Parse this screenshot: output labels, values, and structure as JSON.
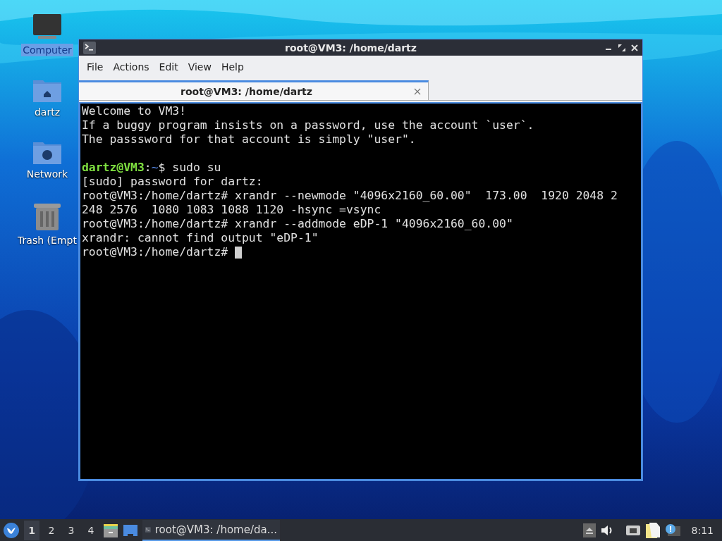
{
  "desktop_icons": [
    {
      "label": "Computer",
      "kind": "computer",
      "selected": true
    },
    {
      "label": "dartz",
      "kind": "home",
      "selected": false
    },
    {
      "label": "Network",
      "kind": "network",
      "selected": false
    },
    {
      "label": "Trash (Empt",
      "kind": "trash",
      "selected": false
    }
  ],
  "window": {
    "title": "root@VM3: /home/dartz",
    "menu": [
      "File",
      "Actions",
      "Edit",
      "View",
      "Help"
    ],
    "tabs": [
      {
        "label": "root@VM3: /home/dartz",
        "selected": true
      }
    ],
    "terminal_lines": [
      {
        "kind": "text",
        "text": "Welcome to VM3!"
      },
      {
        "kind": "text",
        "text": "If a buggy program insists on a password, use the account `user`."
      },
      {
        "kind": "text",
        "text": "The passsword for that account is simply \"user\"."
      },
      {
        "kind": "blank"
      },
      {
        "kind": "prompt",
        "user": "dartz@VM3",
        "sep": ":",
        "path": "~",
        "symbol": "$ ",
        "command": "sudo su"
      },
      {
        "kind": "text",
        "text": "[sudo] password for dartz:"
      },
      {
        "kind": "text",
        "text": "root@VM3:/home/dartz# xrandr --newmode \"4096x2160_60.00\"  173.00  1920 2048 2"
      },
      {
        "kind": "text",
        "text": "248 2576  1080 1083 1088 1120 -hsync =vsync"
      },
      {
        "kind": "text",
        "text": "root@VM3:/home/dartz# xrandr --addmode eDP-1 \"4096x2160_60.00\""
      },
      {
        "kind": "text",
        "text": "xrandr: cannot find output \"eDP-1\""
      },
      {
        "kind": "text",
        "text": "root@VM3:/home/dartz# ",
        "cursor": true
      }
    ]
  },
  "taskbar": {
    "workspaces": [
      {
        "label": "1",
        "selected": true
      },
      {
        "label": "2",
        "selected": false
      },
      {
        "label": "3",
        "selected": false
      },
      {
        "label": "4",
        "selected": false
      }
    ],
    "tasks": [
      {
        "label": "root@VM3: /home/da...",
        "selected": true
      }
    ],
    "clock": "8:11"
  }
}
